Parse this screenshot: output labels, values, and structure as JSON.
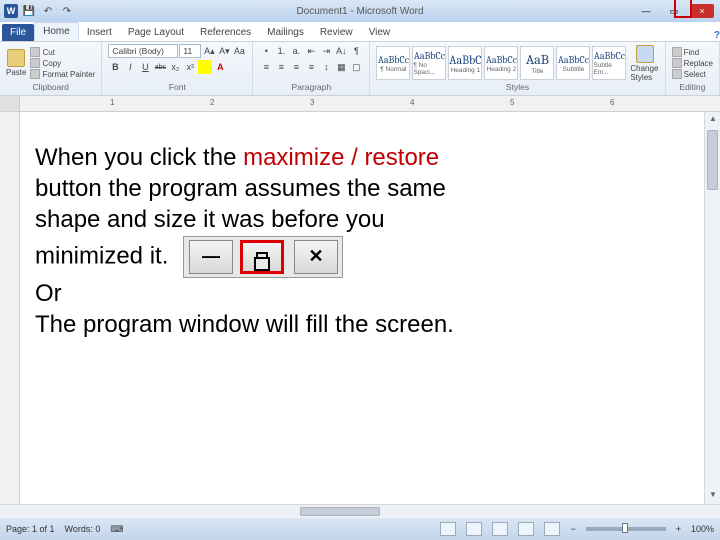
{
  "title": "Document1 - Microsoft Word",
  "qat": {
    "word_letter": "W",
    "save": "💾",
    "undo": "↶",
    "redo": "↷"
  },
  "tabs": [
    "File",
    "Home",
    "Insert",
    "Page Layout",
    "References",
    "Mailings",
    "Review",
    "View"
  ],
  "clipboard": {
    "paste": "Paste",
    "cut": "Cut",
    "copy": "Copy",
    "fmtp": "Format Painter",
    "label": "Clipboard"
  },
  "font": {
    "family": "Calibri (Body)",
    "size": "11",
    "bold": "B",
    "italic": "I",
    "under": "U",
    "strike": "abc",
    "sub": "x₂",
    "sup": "x²",
    "clear": "Aa",
    "color_a": "A",
    "label": "Font"
  },
  "paragraph": {
    "bullets": "•",
    "numbers": "1.",
    "multi": "a.",
    "indent_l": "⇤",
    "indent_r": "⇥",
    "sort": "A↓",
    "align_l": "≡",
    "align_c": "≡",
    "align_r": "≡",
    "align_j": "≡",
    "spacing": "↕",
    "shade": "▦",
    "border": "▢",
    "label": "Paragraph"
  },
  "styles": {
    "items": [
      {
        "aa": "AaBbCc",
        "name": "¶ Normal"
      },
      {
        "aa": "AaBbCc",
        "name": "¶ No Spaci..."
      },
      {
        "aa": "AaBbC",
        "name": "Heading 1"
      },
      {
        "aa": "AaBbCc",
        "name": "Heading 2"
      },
      {
        "aa": "AaB",
        "name": "Title"
      },
      {
        "aa": "AaBbCc",
        "name": "Subtitle"
      },
      {
        "aa": "AaBbCc",
        "name": "Subtle Em..."
      }
    ],
    "change": "Change Styles",
    "label": "Styles"
  },
  "editing": {
    "find": "Find",
    "replace": "Replace",
    "select": "Select",
    "label": "Editing"
  },
  "ruler": {
    "marks": [
      "1",
      "2",
      "3",
      "4",
      "5",
      "6"
    ]
  },
  "overlay": {
    "line1a": "When you click the ",
    "line1b": "maximize / restore",
    "line2": "button the program assumes the same",
    "line3": "shape and size it was before you",
    "line4a": "minimized it.",
    "line5": "Or",
    "line6": "The program window will fill the screen."
  },
  "status": {
    "page": "Page: 1 of 1",
    "words": "Words: 0",
    "lang_icon": "⌨",
    "zoom_minus": "−",
    "zoom_plus": "+",
    "zoom_pct": "100%"
  },
  "win": {
    "min": "—",
    "max": "▭",
    "close": "×",
    "help": "?"
  }
}
